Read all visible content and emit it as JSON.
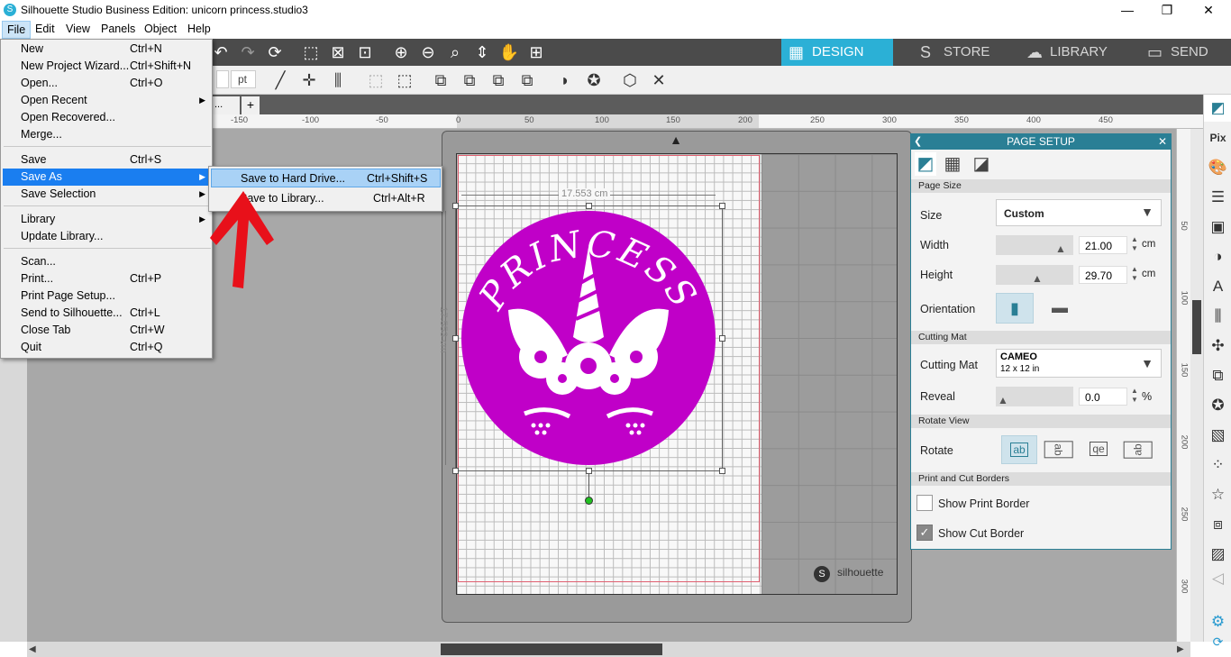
{
  "window": {
    "title": "Silhouette Studio Business Edition: unicorn princess.studio3",
    "minimize": "—",
    "maximize": "❐",
    "close": "✕"
  },
  "menubar": [
    "File",
    "Edit",
    "View",
    "Panels",
    "Object",
    "Help"
  ],
  "nav_tabs": [
    {
      "label": "DESIGN",
      "icon": "▦",
      "active": true
    },
    {
      "label": "STORE",
      "icon": "S",
      "active": false
    },
    {
      "label": "LIBRARY",
      "icon": "☁",
      "active": false
    },
    {
      "label": "SEND",
      "icon": "▭",
      "active": false
    }
  ],
  "toolbar2": {
    "unit": "pt"
  },
  "tab": {
    "name": "...",
    "add": "+"
  },
  "ruler_labels": [
    "-150",
    "-100",
    "-50",
    "0",
    "50",
    "100",
    "150",
    "200",
    "250",
    "300",
    "350",
    "400",
    "450"
  ],
  "vruler_labels": [
    "50",
    "100",
    "150",
    "200",
    "250",
    "300"
  ],
  "file_menu": {
    "items": [
      {
        "label": "New",
        "shortcut": "Ctrl+N"
      },
      {
        "label": "New Project Wizard...",
        "shortcut": "Ctrl+Shift+N"
      },
      {
        "label": "Open...",
        "shortcut": "Ctrl+O"
      },
      {
        "label": "Open Recent",
        "shortcut": "",
        "submenu": true
      },
      {
        "label": "Open Recovered...",
        "shortcut": ""
      },
      {
        "label": "Merge...",
        "shortcut": ""
      },
      {
        "label": "Save",
        "shortcut": "Ctrl+S"
      },
      {
        "label": "Save As",
        "shortcut": "",
        "submenu": true,
        "highlighted": true
      },
      {
        "label": "Save Selection",
        "shortcut": "",
        "submenu": true
      },
      {
        "label": "Library",
        "shortcut": "",
        "submenu": true
      },
      {
        "label": "Update Library...",
        "shortcut": ""
      },
      {
        "label": "Scan...",
        "shortcut": ""
      },
      {
        "label": "Print...",
        "shortcut": "Ctrl+P"
      },
      {
        "label": "Print Page Setup...",
        "shortcut": ""
      },
      {
        "label": "Send to Silhouette...",
        "shortcut": "Ctrl+L"
      },
      {
        "label": "Close Tab",
        "shortcut": "Ctrl+W"
      },
      {
        "label": "Quit",
        "shortcut": "Ctrl+Q"
      }
    ]
  },
  "save_as_submenu": [
    {
      "label": "Save to Hard Drive...",
      "shortcut": "Ctrl+Shift+S",
      "highlighted": true
    },
    {
      "label": "Save to Library...",
      "shortcut": "Ctrl+Alt+R"
    }
  ],
  "canvas": {
    "dimension_h": "17.553 cm",
    "dimension_v": "17.553 cm",
    "artwork_text": "PRINCESS",
    "artwork_color": "#c000c8",
    "brand": "silhouette"
  },
  "page_setup": {
    "title": "PAGE SETUP",
    "close": "✕",
    "sections": {
      "page_size": "Page Size",
      "cutting_mat": "Cutting Mat",
      "rotate_view": "Rotate View",
      "borders": "Print and Cut Borders"
    },
    "size_label": "Size",
    "size_value": "Custom",
    "width_label": "Width",
    "width_value": "21.00",
    "height_label": "Height",
    "height_value": "29.70",
    "unit": "cm",
    "orientation_label": "Orientation",
    "cutting_mat_label": "Cutting Mat",
    "mat_name": "CAMEO",
    "mat_size": "12 x 12 in",
    "reveal_label": "Reveal",
    "reveal_value": "0.0",
    "reveal_unit": "%",
    "rotate_label": "Rotate",
    "rotate_options": [
      "ab",
      "ab",
      "qe",
      "ab"
    ],
    "show_print_border": {
      "label": "Show Print Border",
      "checked": false
    },
    "show_cut_border": {
      "label": "Show Cut Border",
      "checked": true
    }
  },
  "accent_color": "#2bb0d6",
  "annotation_arrow_color": "#e8101a"
}
